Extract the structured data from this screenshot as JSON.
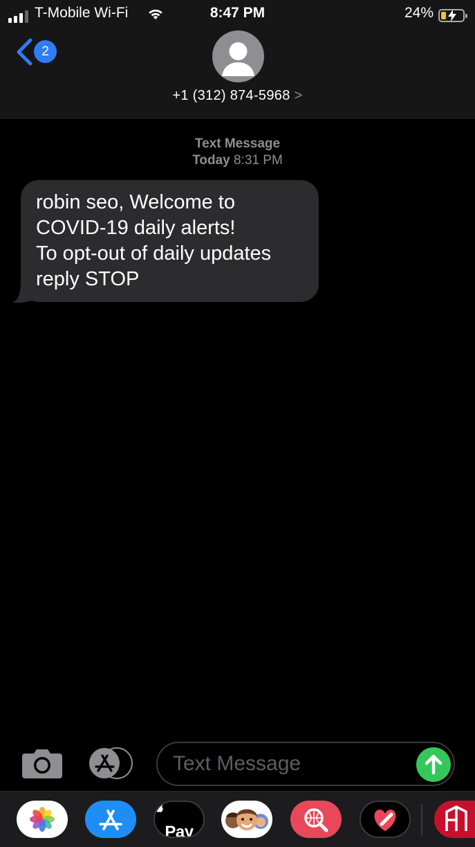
{
  "status_bar": {
    "carrier": "T-Mobile Wi-Fi",
    "time": "8:47 PM",
    "battery_percent": "24%",
    "battery_level": 0.24,
    "charging": true,
    "signal_bars": 4,
    "signal_strength": 3,
    "icons": [
      "signal-bars-icon",
      "wifi-icon",
      "battery-charging-icon"
    ]
  },
  "nav": {
    "back_icon": "chevron-left-icon",
    "unread_count": "2",
    "contact_name": "+1 (312) 874-5968",
    "contact_chevron": ">",
    "avatar_icon": "person-silhouette-icon"
  },
  "conversation": {
    "service_label": "Text Message",
    "day_label": "Today",
    "time_label": "8:31 PM",
    "messages": [
      {
        "direction": "incoming",
        "lines": [
          "robin seo, Welcome to",
          "COVID-19 daily alerts!",
          "To opt-out of daily updates",
          "reply STOP"
        ]
      }
    ]
  },
  "compose": {
    "placeholder": "Text Message",
    "value": "",
    "camera_icon": "camera-icon",
    "apps_icon": "app-store-icon",
    "send_icon": "arrow-up-icon"
  },
  "app_drawer": {
    "apps": [
      {
        "name": "photos",
        "icon": "photos-icon"
      },
      {
        "name": "app-store",
        "icon": "app-store-icon"
      },
      {
        "name": "apple-pay",
        "icon": "apple-pay-icon",
        "label": "Pay",
        "logo": ""
      },
      {
        "name": "memoji",
        "icon": "memoji-icon"
      },
      {
        "name": "web-search",
        "icon": "web-search-icon"
      },
      {
        "name": "digital-touch",
        "icon": "digital-touch-icon"
      },
      {
        "name": "extension",
        "icon": "building-app-icon"
      }
    ]
  },
  "colors": {
    "background": "#000000",
    "header": "#161616",
    "bubble_incoming": "#2c2c2e",
    "accent_blue": "#2f7cf6",
    "send_green": "#34c759",
    "secondary_text": "#8e8e93",
    "battery_yellow": "#f5c518"
  }
}
